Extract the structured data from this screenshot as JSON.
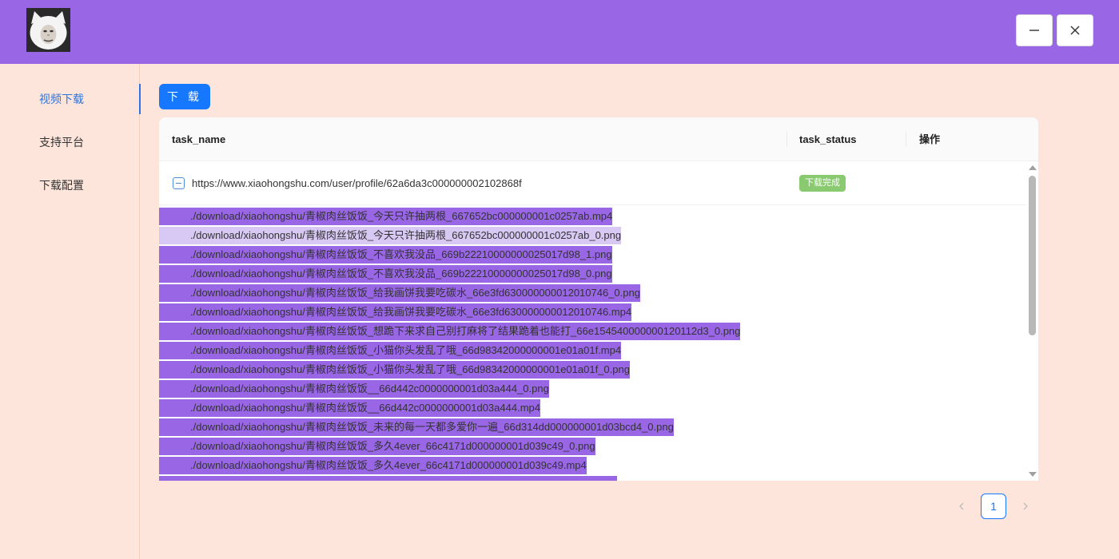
{
  "colors": {
    "header": "#9966e6",
    "background": "#fde5db",
    "accent": "#1677ff",
    "highlight": "#9966e6",
    "highlight_light": "#d8c8f4",
    "status_done": "#89c96f"
  },
  "window_controls": {
    "minimize_icon": "minus-icon",
    "close_icon": "x-icon"
  },
  "sidebar": {
    "items": [
      {
        "label": "视频下载",
        "active": true
      },
      {
        "label": "支持平台",
        "active": false
      },
      {
        "label": "下载配置",
        "active": false
      }
    ]
  },
  "toolbar": {
    "download_label": "下 载"
  },
  "table": {
    "columns": [
      "task_name",
      "task_status",
      "操作"
    ],
    "row": {
      "task_name": "https://www.xiaohongshu.com/user/profile/62a6da3c000000002102868f",
      "task_status": "下载完成"
    },
    "files": [
      "./download/xiaohongshu/青椒肉丝饭饭_今天只许抽两根_667652bc000000001c0257ab.mp4",
      "./download/xiaohongshu/青椒肉丝饭饭_今天只许抽两根_667652bc000000001c0257ab_0.png",
      "./download/xiaohongshu/青椒肉丝饭饭_不喜欢我没品_669b22210000000025017d98_1.png",
      "./download/xiaohongshu/青椒肉丝饭饭_不喜欢我没品_669b22210000000025017d98_0.png",
      "./download/xiaohongshu/青椒肉丝饭饭_给我画饼我要吃碳水_66e3fd630000000012010746_0.png",
      "./download/xiaohongshu/青椒肉丝饭饭_给我画饼我要吃碳水_66e3fd630000000012010746.mp4",
      "./download/xiaohongshu/青椒肉丝饭饭_想跪下来求自己别打麻将了结果跪着也能打_66e154540000000120112d3_0.png",
      "./download/xiaohongshu/青椒肉丝饭饭_小猫你头发乱了哦_66d98342000000001e01a01f.mp4",
      "./download/xiaohongshu/青椒肉丝饭饭_小猫你头发乱了哦_66d98342000000001e01a01f_0.png",
      "./download/xiaohongshu/青椒肉丝饭饭__66d442c0000000001d03a444_0.png",
      "./download/xiaohongshu/青椒肉丝饭饭__66d442c0000000001d03a444.mp4",
      "./download/xiaohongshu/青椒肉丝饭饭_未来的每一天都多爱你一遍_66d314dd000000001d03bcd4_0.png",
      "./download/xiaohongshu/青椒肉丝饭饭_多久4ever_66c4171d000000001d039c49_0.png",
      "./download/xiaohongshu/青椒肉丝饭饭_多久4ever_66c4171d000000001d039c49.mp4",
      ""
    ]
  },
  "pagination": {
    "current": "1"
  }
}
